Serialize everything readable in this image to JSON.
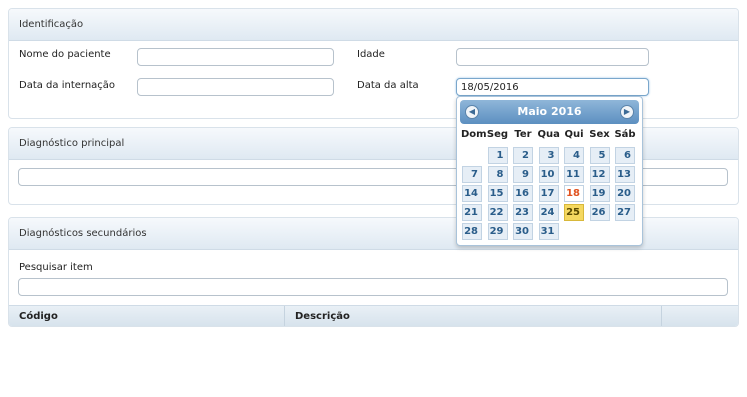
{
  "identificacao": {
    "header": "Identificação",
    "nome_label": "Nome do paciente",
    "nome_value": "",
    "idade_label": "Idade",
    "idade_value": "",
    "data_internacao_label": "Data da internação",
    "data_internacao_value": "",
    "data_alta_label": "Data da alta",
    "data_alta_value": "18/05/2016"
  },
  "diagnostico_principal": {
    "header": "Diagnóstico principal",
    "value": ""
  },
  "diagnosticos_secundarios": {
    "header": "Diagnósticos secundários",
    "search_label": "Pesquisar item",
    "search_value": "",
    "columns": [
      "Código",
      "Descrição",
      ""
    ]
  },
  "calendar": {
    "month_label": "Maio  2016",
    "prev_icon": "prev-circle-icon",
    "next_icon": "next-circle-icon",
    "weekdays": [
      "Dom",
      "Seg",
      "Ter",
      "Qua",
      "Qui",
      "Sex",
      "Sáb"
    ],
    "first_weekday_index": 1,
    "days_in_month": 31,
    "today": 18,
    "selected": 25,
    "colors": {
      "header": "#5c8fc0",
      "today_text": "#e0521f",
      "selected_bg": "#f5d860"
    }
  }
}
